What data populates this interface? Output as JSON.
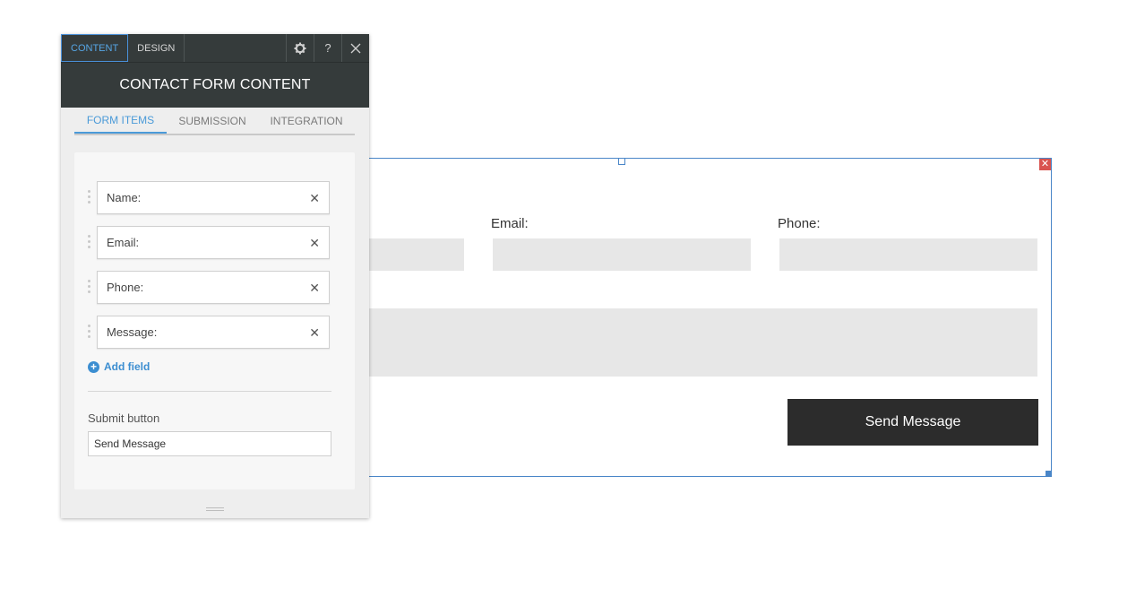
{
  "panel": {
    "top_tabs": [
      {
        "label": "CONTENT",
        "active": true
      },
      {
        "label": "DESIGN",
        "active": false
      }
    ],
    "icons": {
      "settings": "gear-icon",
      "help": "?",
      "close": "close-icon"
    },
    "title": "CONTACT FORM CONTENT",
    "sub_tabs": [
      {
        "label": "FORM ITEMS",
        "active": true
      },
      {
        "label": "SUBMISSION",
        "active": false
      },
      {
        "label": "INTEGRATION",
        "active": false
      }
    ],
    "form_items": [
      {
        "label": "Name:"
      },
      {
        "label": "Email:"
      },
      {
        "label": "Phone:"
      },
      {
        "label": "Message:"
      }
    ],
    "add_field_label": "Add field",
    "submit_section_label": "Submit button",
    "submit_button_value": "Send Message"
  },
  "form": {
    "email_label": "Email:",
    "phone_label": "Phone:",
    "send_button_label": "Send Message"
  },
  "colors": {
    "accent": "#4a9ad8",
    "panel_dark": "#353b3b",
    "button_dark": "#2c2c2c",
    "delete_red": "#d9534f"
  }
}
